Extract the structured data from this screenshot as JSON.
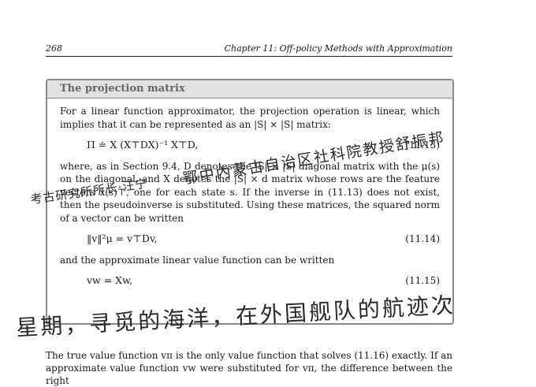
{
  "header": {
    "page_number": "268",
    "chapter": "Chapter 11: Off-policy Methods with Approximation"
  },
  "box": {
    "title": "The projection matrix",
    "para1": "For a linear function approximator, the projection operation is linear, which implies that it can be represented as an |S| × |S| matrix:",
    "eq1": "Π ≐ X (X⊤DX)⁻¹ X⊤D,",
    "eq1_num": "(11.13)",
    "para2": "where, as in Section 9.4, D denotes the |S| × |S| diagonal matrix with the μ(s) on the diagonal, and X denotes the |S| × d matrix whose rows are the feature vectors x(s)⊤, one for each state s. If the inverse in (11.13) does not exist, then the pseudoinverse is substituted. Using these matrices, the squared norm of a vector can be written",
    "eq2": "‖v‖²μ = v⊤Dv,",
    "eq2_num": "(11.14)",
    "para3": "and the approximate linear value function can be written",
    "eq3": "vw = Xw,",
    "eq3_num": "(11.15)"
  },
  "bottom_text": "The true value function vπ is the only value function that solves (11.16) exactly. If an approximate value function vw were substituted for vπ, the difference between the right",
  "handwriting": {
    "line1": "鄂中內蒙古自治区社科院教授舒振邦",
    "line2": "考古研究所所长·汪宁",
    "line3": "星期，寻觅的海洋，在外国舰队的航迹次"
  }
}
